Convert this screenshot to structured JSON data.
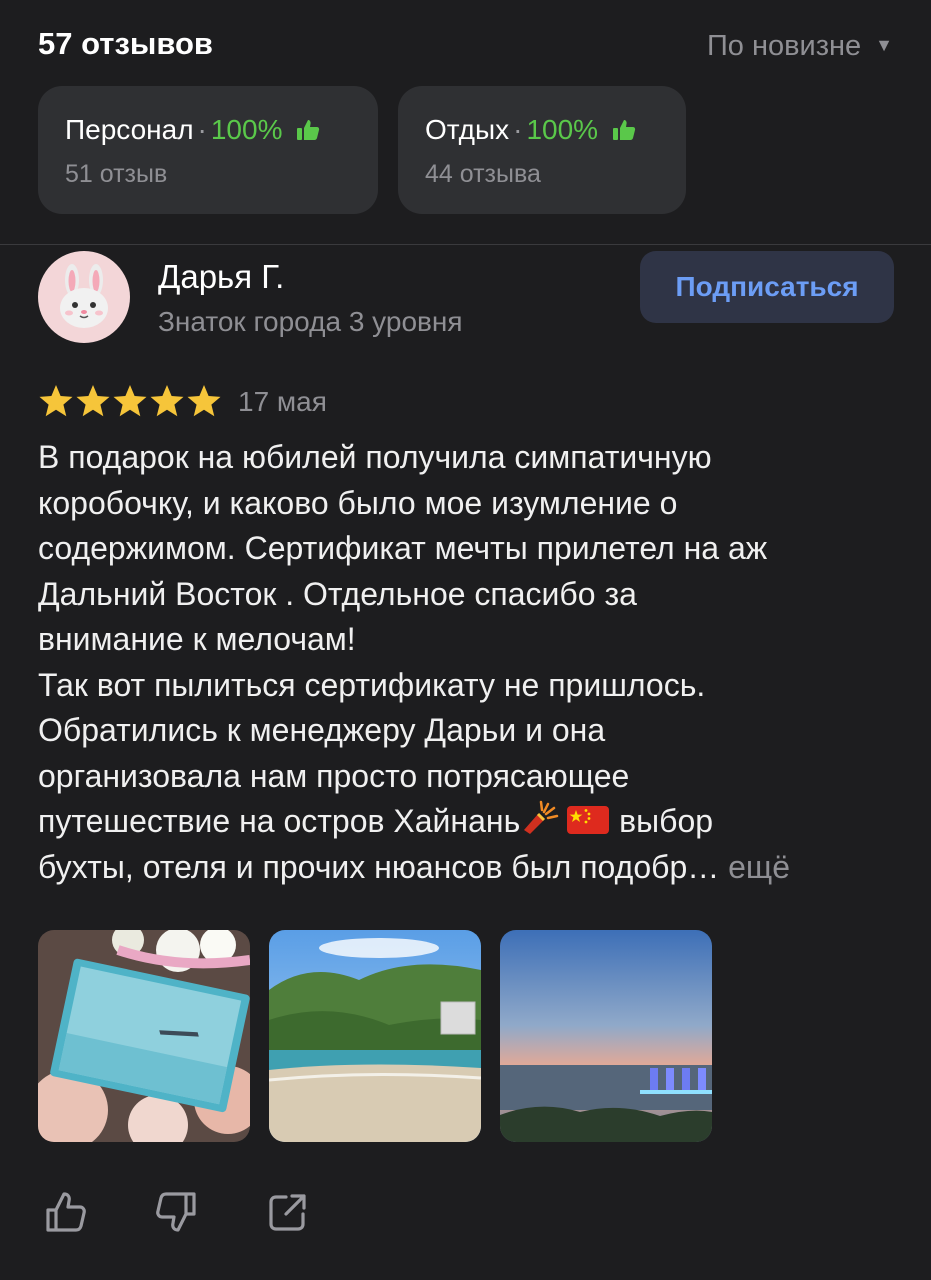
{
  "header": {
    "reviews_count": "57 отзывов",
    "sort_label": "По новизне"
  },
  "aspects": [
    {
      "name": "Персонал",
      "percent": "100%",
      "reviews": "51 отзыв"
    },
    {
      "name": "Отдых",
      "percent": "100%",
      "reviews": "44 отзыва"
    }
  ],
  "author": {
    "name": "Дарья Г.",
    "level": "Знаток города 3 уровня",
    "subscribe_label": "Подписаться"
  },
  "review": {
    "rating": 5,
    "date": "17 мая",
    "lines": [
      "В подарок на юбилей получила  симпатичную",
      "коробочку, и каково было мое изумление о",
      "содержимом. Сертификат мечты прилетел на аж",
      "Дальний Восток . Отдельное спасибо за",
      "внимание к мелочам!",
      "Так вот пылиться сертификату не пришлось.",
      "Обратились к менеджеру Дарьи и она",
      "организовала нам просто потрясающее",
      "путешествие на остров Хайнань",
      " выбор",
      "бухты, отеля и прочих нюансов был подобр…",
      " ещё"
    ]
  },
  "photos": [
    "gift-box-photo",
    "beach-photo",
    "sunset-sea-photo"
  ],
  "colors": {
    "accent_green": "#5ac84a",
    "link_blue": "#6c9df5",
    "star_yellow": "#f6c53a",
    "background": "#1d1d1f"
  }
}
